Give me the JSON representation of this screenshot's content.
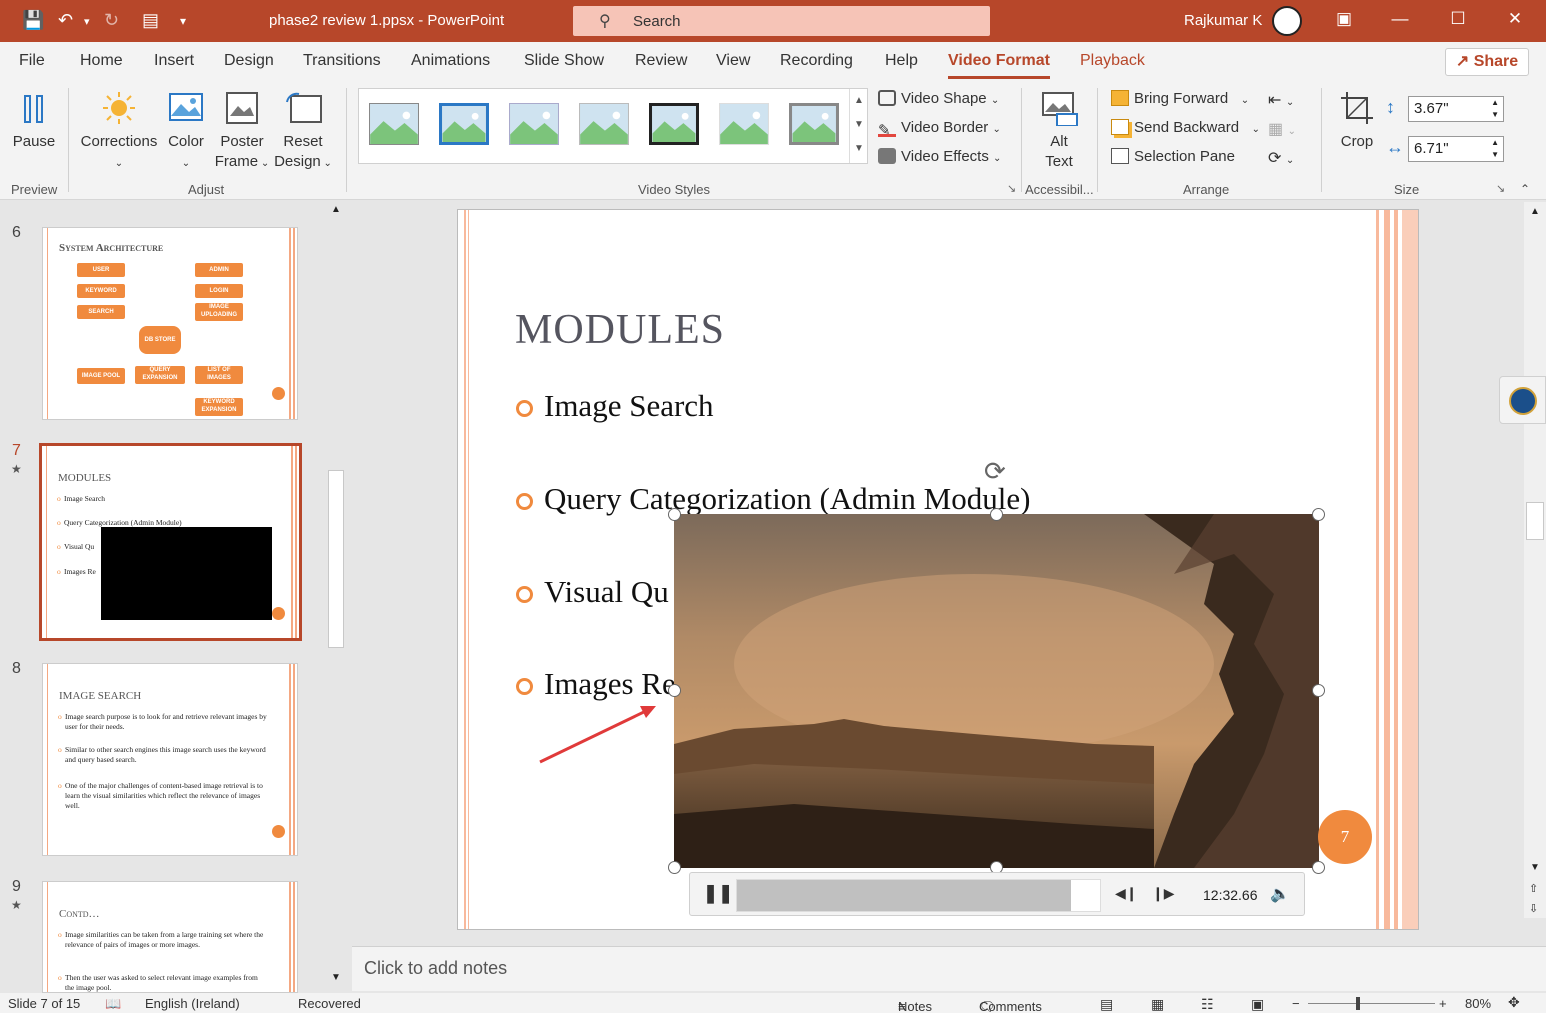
{
  "titlebar": {
    "doc_title": "phase2 review 1.ppsx  -  PowerPoint",
    "search_placeholder": "Search",
    "user_name": "Rajkumar K"
  },
  "tabs": [
    "File",
    "Home",
    "Insert",
    "Design",
    "Transitions",
    "Animations",
    "Slide Show",
    "Review",
    "View",
    "Recording",
    "Help",
    "Video Format",
    "Playback"
  ],
  "share_label": "Share",
  "ribbon": {
    "preview": {
      "pause": "Pause",
      "group": "Preview"
    },
    "adjust": {
      "corrections": "Corrections",
      "color": "Color",
      "poster": "Poster",
      "frame": "Frame",
      "reset": "Reset",
      "design": "Design",
      "group": "Adjust"
    },
    "video_styles": {
      "video_shape": "Video Shape",
      "video_border": "Video Border",
      "video_effects": "Video Effects",
      "group": "Video Styles"
    },
    "accessibility": {
      "alt": "Alt",
      "text": "Text",
      "group": "Accessibil..."
    },
    "arrange": {
      "bring_forward": "Bring Forward",
      "send_backward": "Send Backward",
      "selection_pane": "Selection Pane",
      "group": "Arrange"
    },
    "size": {
      "crop": "Crop",
      "height": "3.67\"",
      "width": "6.71\"",
      "group": "Size"
    }
  },
  "thumbnails": {
    "s6": {
      "num": "6",
      "title": "System Architecture",
      "boxes": [
        "USER",
        "ADMIN",
        "KEYWORD",
        "LOGIN",
        "SEARCH",
        "IMAGE UPLOADING",
        "DB STORE",
        "IMAGE POOL",
        "QUERY EXPANSION",
        "LIST OF IMAGES",
        "KEYWORD EXPANSION"
      ]
    },
    "s7": {
      "num": "7",
      "title": "MODULES",
      "items": [
        "Image Search",
        "Query Categorization (Admin Module)",
        "Visual Qu",
        "Images Re"
      ]
    },
    "s8": {
      "num": "8",
      "title": "IMAGE SEARCH",
      "items": [
        "Image search purpose is to look for and retrieve relevant images by user for their needs.",
        "Similar to other search engines this image search uses the keyword and query based search.",
        "One of the major challenges of content-based image retrieval is to learn the visual similarities which reflect the relevance of images well."
      ]
    },
    "s9": {
      "num": "9",
      "title": "Contd…",
      "items": [
        "Image similarities can be taken from a large training set where the relevance of pairs of images or more images.",
        "Then the user was asked to select relevant image examples from the image pool."
      ]
    }
  },
  "slide": {
    "title": "MODULES",
    "bullets": [
      "Image Search",
      "Query Categorization (Admin Module)",
      "Visual Qu",
      "Images Re"
    ],
    "number": "7"
  },
  "player": {
    "time": "12:32.66",
    "progress": 0.92
  },
  "notes_placeholder": "Click to add notes",
  "status": {
    "slide": "Slide 7 of 15",
    "language": "English (Ireland)",
    "recovered": "Recovered",
    "notes": "Notes",
    "comments": "Comments",
    "zoom": "80%"
  }
}
